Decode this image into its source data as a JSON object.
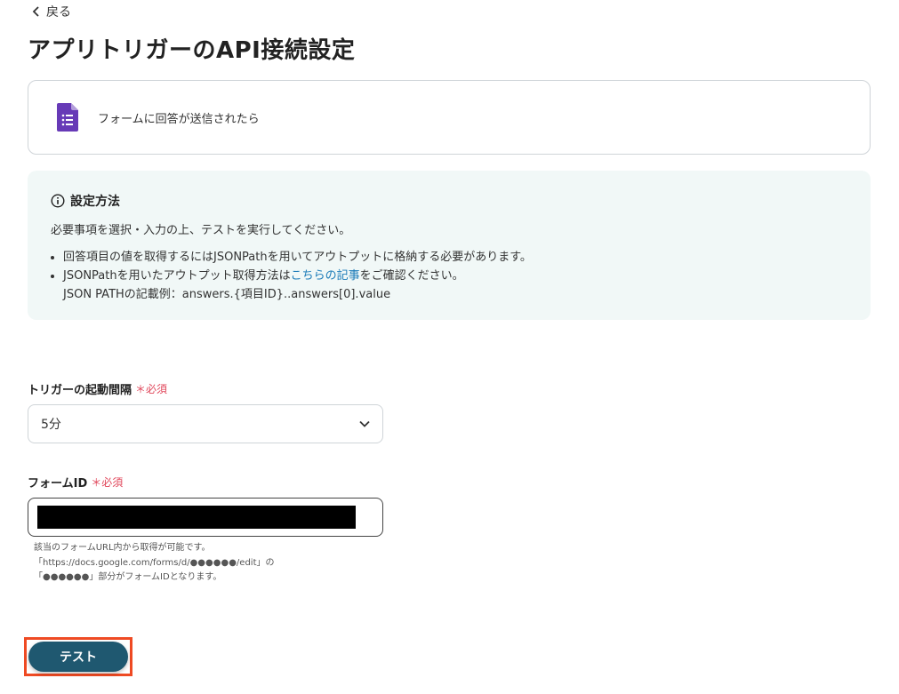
{
  "nav": {
    "back_label": "戻る"
  },
  "page": {
    "title": "アプリトリガーのAPI接続設定"
  },
  "trigger_card": {
    "icon": "google-forms-icon",
    "label": "フォームに回答が送信されたら"
  },
  "info": {
    "title": "設定方法",
    "description": "必要事項を選択・入力の上、テストを実行してください。",
    "bullet_1": "回答項目の値を取得するにはJSONPathを用いてアウトプットに格納する必要があります。",
    "bullet_2_prefix": "JSONPathを用いたアウトプット取得方法は",
    "bullet_2_link": "こちらの記事",
    "bullet_2_suffix": "をご確認ください。",
    "bullet_2_line2": "JSON PATHの記載例：answers.{項目ID}..answers[0].value"
  },
  "interval_field": {
    "label": "トリガーの起動間隔",
    "required": "＊必須",
    "value": "5分"
  },
  "form_id_field": {
    "label": "フォームID",
    "required": "＊必須",
    "help_1": "該当のフォームURL内から取得が可能です。",
    "help_2": "「https://docs.google.com/forms/d/●●●●●●/edit」の",
    "help_3": "「●●●●●●」部分がフォームIDとなります。"
  },
  "actions": {
    "test_label": "テスト"
  },
  "colors": {
    "primary_button": "#1f5870",
    "info_bg": "#f1f8f7",
    "required": "#e0465a",
    "link": "#1a7ab8",
    "highlight": "#ef4a23",
    "forms_purple": "#673ab7"
  }
}
